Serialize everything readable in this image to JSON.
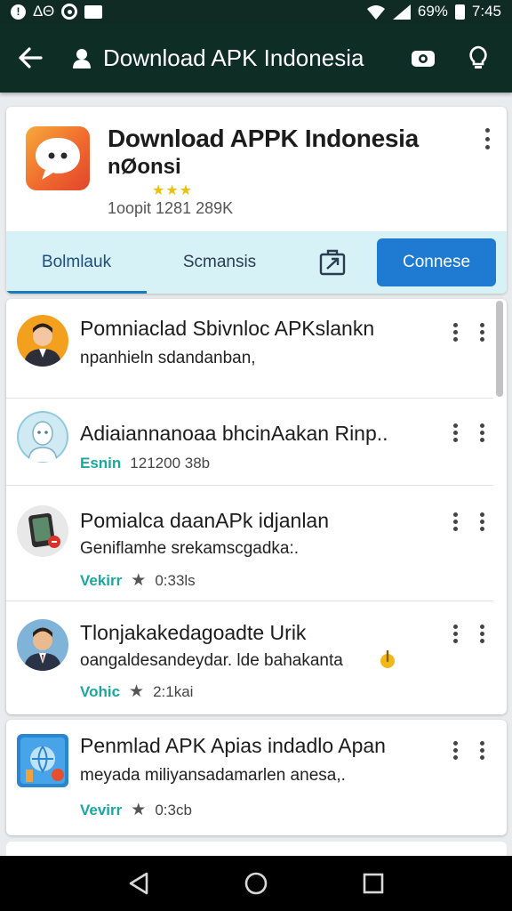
{
  "status_bar": {
    "left_text": "ΔΘ",
    "battery": "69%",
    "time": "7:45"
  },
  "app_bar": {
    "title": "Download APK Indonesia",
    "icons": [
      "back-arrow-icon",
      "user-icon",
      "camera-icon",
      "lightbulb-icon"
    ]
  },
  "app_header": {
    "name": "Download APPK Indonesia",
    "subtitle": "nØonsi",
    "stars": "★★★",
    "stats": "1oopit 1281 289K"
  },
  "tabs": {
    "bookmark": "Bolmlauk",
    "summary": "Scmansis",
    "connect": "Connese"
  },
  "list": {
    "items": [
      {
        "title": "Pomniaclad Sbivnloc APKslankn",
        "desc": "npanhieln sdandanban,",
        "meta_tag": "",
        "meta_value": ""
      },
      {
        "title": "Adiaiannanoaa bhcinAakan Rinp..",
        "desc": "",
        "meta_tag": "Esnin",
        "meta_value": "121200 38b"
      },
      {
        "title": "Pomialca daanAPk idjanlan",
        "desc": "Geniflamhe srekamscgadka:.",
        "meta_tag": "Vekirr",
        "meta_value": "0:33ls"
      },
      {
        "title": "Tlonjakakedagoadte Urik",
        "desc": "oangaldesandeydar. lde bahakanta",
        "meta_tag": "Vohic",
        "meta_value": "2:1kai"
      },
      {
        "title": "Penmlad APK Apias indadlo Apan",
        "desc": "meyada miliyansadamarlen anesa,.",
        "meta_tag": "Vevirr",
        "meta_value": "0:3cb"
      }
    ]
  },
  "colors": {
    "app_bar": "#0e2d24",
    "tab_strip": "#d7f2f6",
    "connect_button": "#1f7ad1",
    "meta_tag": "#1aa7a0"
  }
}
